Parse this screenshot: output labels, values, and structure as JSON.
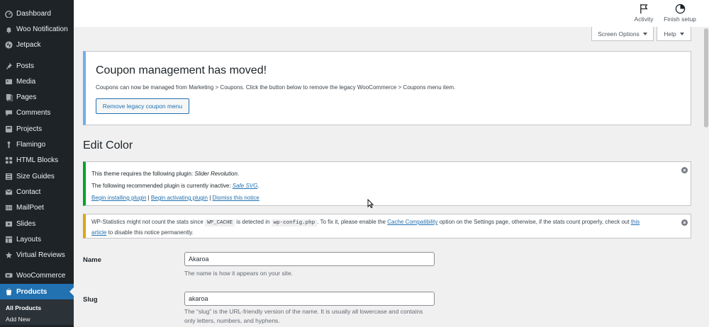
{
  "sidebar": {
    "items_top": [
      {
        "label": "Dashboard",
        "icon": "dashboard-icon"
      },
      {
        "label": "Woo Notification",
        "icon": "bell-icon"
      },
      {
        "label": "Jetpack",
        "icon": "jetpack-icon"
      }
    ],
    "items_mid": [
      {
        "label": "Posts",
        "icon": "pin-icon"
      },
      {
        "label": "Media",
        "icon": "media-icon"
      },
      {
        "label": "Pages",
        "icon": "pages-icon"
      },
      {
        "label": "Comments",
        "icon": "comments-icon"
      },
      {
        "label": "Projects",
        "icon": "projects-icon"
      },
      {
        "label": "Flamingo",
        "icon": "flamingo-icon"
      },
      {
        "label": "HTML Blocks",
        "icon": "blocks-icon"
      },
      {
        "label": "Size Guides",
        "icon": "size-guides-icon"
      },
      {
        "label": "Contact",
        "icon": "mail-icon"
      },
      {
        "label": "MailPoet",
        "icon": "mailpoet-icon"
      },
      {
        "label": "Slides",
        "icon": "slides-icon"
      },
      {
        "label": "Layouts",
        "icon": "layouts-icon"
      },
      {
        "label": "Virtual Reviews",
        "icon": "star-icon"
      }
    ],
    "items_bottom": [
      {
        "label": "WooCommerce",
        "icon": "woocommerce-icon"
      },
      {
        "label": "Products",
        "icon": "products-icon",
        "active": true
      }
    ],
    "submenu": [
      "All Products",
      "Add New"
    ]
  },
  "topbar": {
    "activity_label": "Activity",
    "finish_setup_label": "Finish setup"
  },
  "screen_options_label": "Screen Options",
  "help_label": "Help",
  "coupon_notice": {
    "title": "Coupon management has moved!",
    "text": "Coupons can now be managed from Marketing > Coupons. Click the button below to remove the legacy WooCommerce > Coupons menu item.",
    "button": "Remove legacy coupon menu"
  },
  "page_title": "Edit Color",
  "plugin_notice": {
    "line1_prefix": "This theme requires the following plugin: ",
    "line1_plugin": "Slider Revolution",
    "line1_suffix": ".",
    "line2_prefix": "The following recommended plugin is currently inactive: ",
    "line2_plugin": "Safe SVG",
    "line2_suffix": ".",
    "link_install": "Begin installing plugin",
    "sep": " | ",
    "link_activate": "Begin activating plugin",
    "link_dismiss": "Dismiss this notice"
  },
  "stats_notice": {
    "part1": "WP-Statistics might not count the stats since ",
    "code1": "WP_CACHE",
    "part2": " is detected in ",
    "code2": "wp-config.php",
    "part3": ". To fix it, please enable the ",
    "link1": "Cache Compatibility",
    "part4": " option on the Settings page, otherwise, if the stats count properly, check out ",
    "link2a": "this",
    "link2b": "article",
    "part5": " to disable this notice permanently."
  },
  "form": {
    "name_label": "Name",
    "name_value": "Akaroa",
    "name_desc": "The name is how it appears on your site.",
    "slug_label": "Slug",
    "slug_value": "akaroa",
    "slug_desc": "The “slug” is the URL-friendly version of the name. It is usually all lowercase and contains only letters, numbers, and hyphens."
  }
}
